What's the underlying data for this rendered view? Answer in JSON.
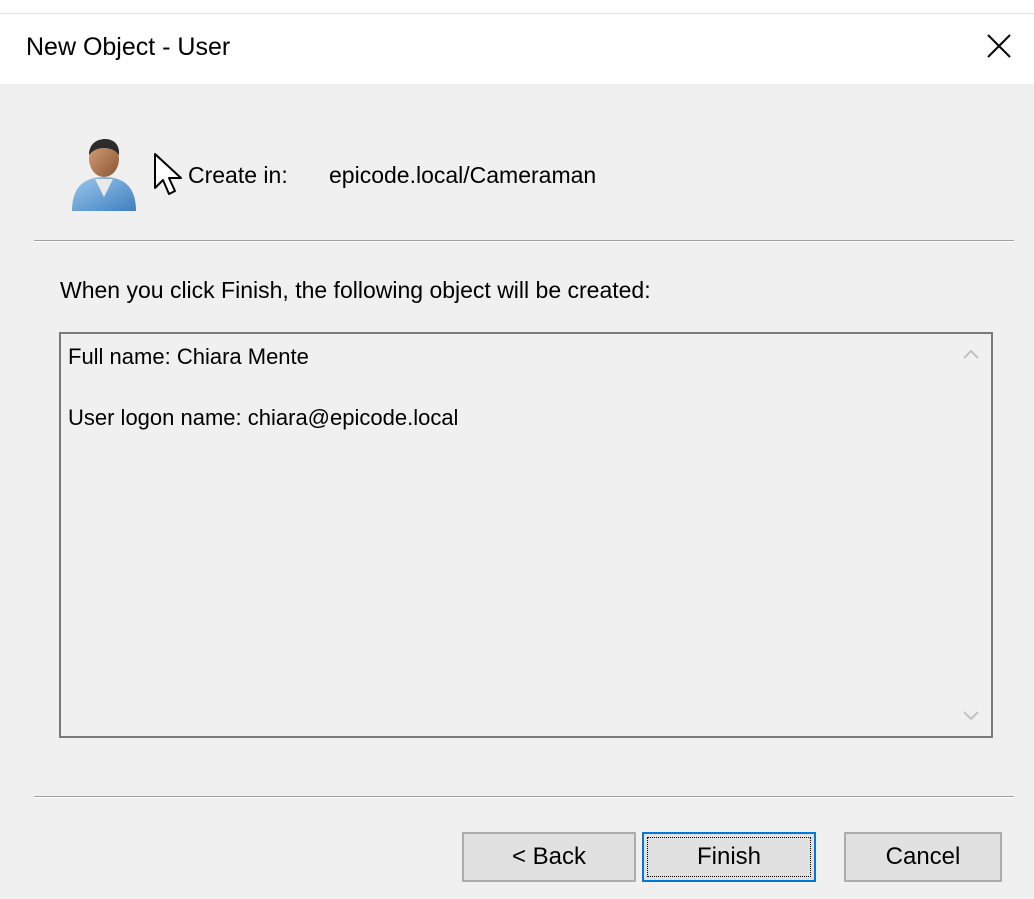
{
  "window": {
    "title": "New Object - User",
    "close_label": "Close"
  },
  "header": {
    "create_in_label": "Create in:",
    "create_in_value": "epicode.local/Cameraman",
    "icon": "user-icon"
  },
  "main": {
    "instruction": "When you click Finish, the following object will be created:",
    "summary": [
      "Full name: Chiara Mente",
      "User logon name: chiara@epicode.local"
    ]
  },
  "buttons": {
    "back": "< Back",
    "finish": "Finish",
    "cancel": "Cancel"
  },
  "colors": {
    "background": "#f0f0f0",
    "focus_border": "#0078d7",
    "button_face": "#e1e1e1"
  }
}
